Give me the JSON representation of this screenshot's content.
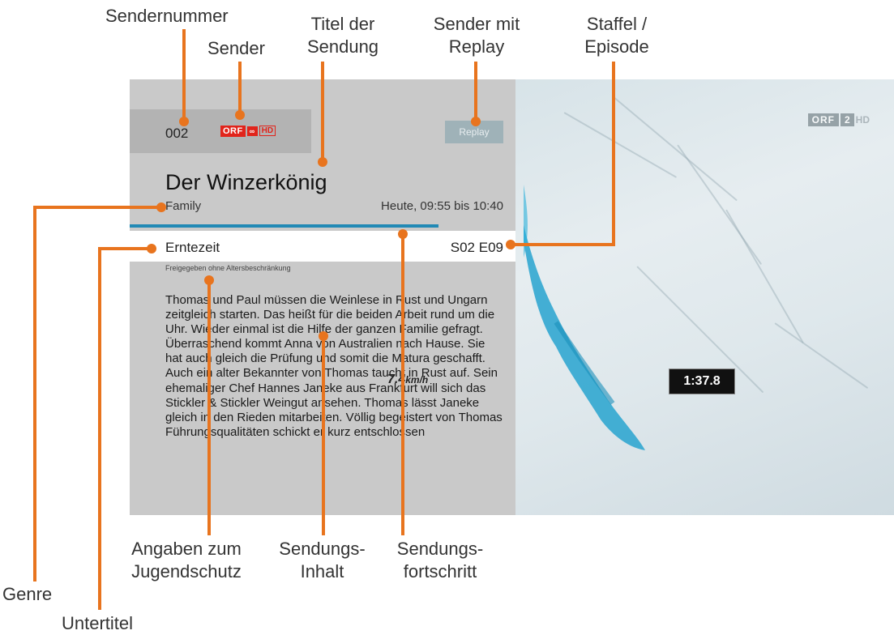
{
  "annotations": {
    "channel_number": "Sendernummer",
    "channel": "Sender",
    "show_title_line1": "Titel der",
    "show_title_line2": "Sendung",
    "replay_line1": "Sender mit",
    "replay_line2": "Replay",
    "season_line1": "Staffel /",
    "season_line2": "Episode",
    "genre": "Genre",
    "subtitle": "Untertitel",
    "youth_line1": "Angaben zum",
    "youth_line2": "Jugendschutz",
    "content_line1": "Sendungs-",
    "content_line2": "Inhalt",
    "progress_line1": "Sendungs-",
    "progress_line2": "fortschritt"
  },
  "info_panel": {
    "channel_number": "002",
    "channel_logo": {
      "orf": "ORF",
      "two": "2",
      "hd": "HD"
    },
    "replay_label": "Replay",
    "title": "Der Winzerkönig",
    "genre": "Family",
    "airtime": "Heute, 09:55 bis 10:40",
    "progress_percent": 80,
    "subtitle": "Erntezeit",
    "episode": "S02 E09",
    "age_rating": "Freigegeben ohne Altersbeschränkung",
    "description": "Thomas und Paul müssen die Weinlese in Rust und Ungarn zeitgleich starten. Das heißt für die beiden Arbeit rund um die Uhr. Wieder einmal ist die Hilfe der ganzen Familie gefragt. Überraschend kommt Anna von Australien nach Hause. Sie hat auch gleich die Prüfung und somit die Matura geschafft. Auch ein alter Bekannter von Thomas taucht in Rust auf. Sein ehemaliger Chef Hannes Janeke aus Frankfurt will sich das Stickler & Stickler Weingut ansehen. Thomas lässt Janeke gleich in den Rieden mitarbeiten. Völlig begeistert von Thomas Führungsqualitäten schickt er kurz entschlossen"
  },
  "video": {
    "tv_logo": {
      "orf": "ORF",
      "num": "2",
      "hd": "HD"
    },
    "speed_value": "7.4",
    "speed_unit": "km/h",
    "timer": "1:37.8"
  },
  "colors": {
    "annotation_orange": "#e8741e",
    "progress_blue": "#2189b5",
    "orf_red": "#e1241b",
    "panel_grey": "#c9c9c9"
  }
}
